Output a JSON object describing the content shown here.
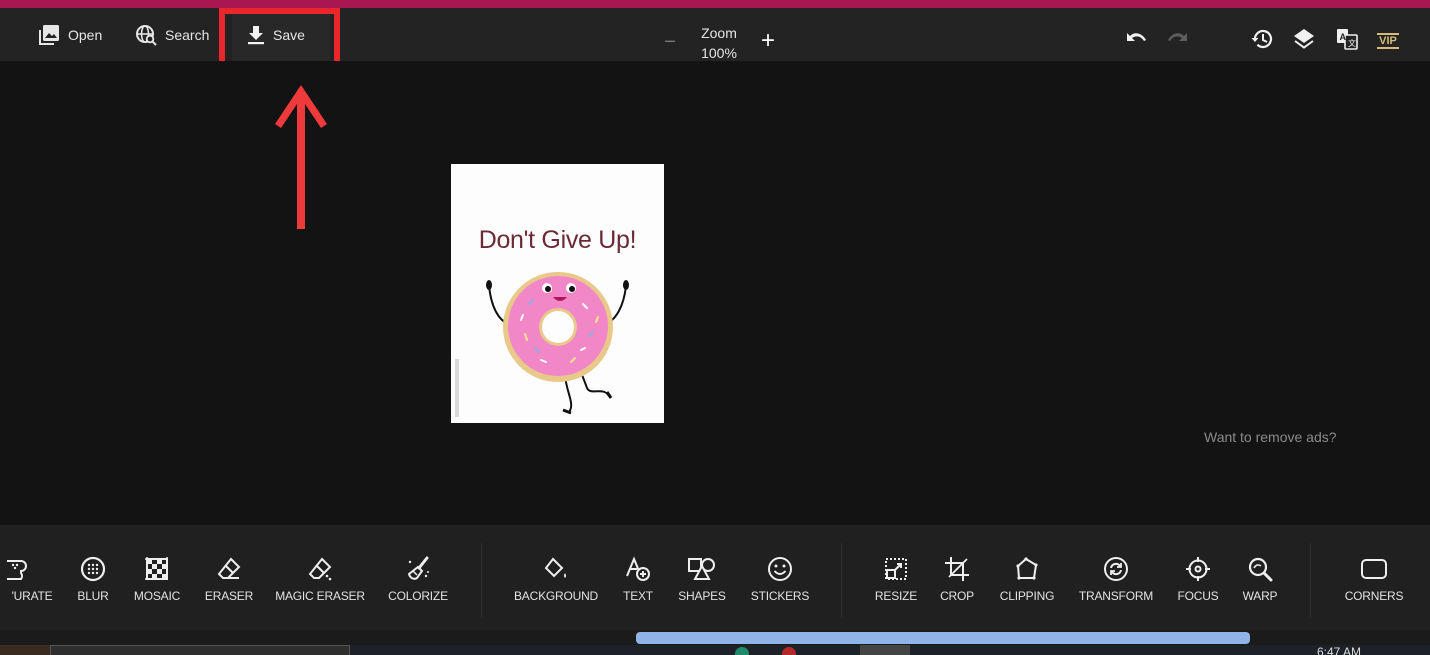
{
  "topbar": {
    "open_label": "Open",
    "search_label": "Search",
    "save_label": "Save",
    "zoom_title": "Zoom",
    "zoom_value": "100%",
    "zoom_minus": "−",
    "zoom_plus": "+",
    "vip_label": "VIP",
    "icons": [
      "image-open-icon",
      "globe-search-icon",
      "download-icon",
      "undo-icon",
      "redo-icon",
      "history-icon",
      "layers-icon",
      "translate-icon",
      "vip-icon"
    ]
  },
  "annotation": {
    "highlight_target": "Save",
    "highlight_color": "#e8262b"
  },
  "canvas": {
    "image_title": "Don't Give Up!",
    "image_subject": "dancing pink frosted donut with sprinkles",
    "remove_ads_link": "Want to remove ads?"
  },
  "toolbar": {
    "groups": [
      {
        "tools": [
          {
            "label": "'URATE",
            "icon": "saturate-icon"
          },
          {
            "label": "BLUR",
            "icon": "blur-icon"
          },
          {
            "label": "MOSAIC",
            "icon": "mosaic-icon"
          },
          {
            "label": "ERASER",
            "icon": "eraser-icon"
          },
          {
            "label": "MAGIC ERASER",
            "icon": "magic-eraser-icon"
          },
          {
            "label": "COLORIZE",
            "icon": "colorize-brush-icon"
          }
        ]
      },
      {
        "tools": [
          {
            "label": "BACKGROUND",
            "icon": "paint-bucket-icon"
          },
          {
            "label": "TEXT",
            "icon": "add-text-icon"
          },
          {
            "label": "SHAPES",
            "icon": "shapes-icon"
          },
          {
            "label": "STICKERS",
            "icon": "smiley-icon"
          }
        ]
      },
      {
        "tools": [
          {
            "label": "RESIZE",
            "icon": "resize-icon"
          },
          {
            "label": "CROP",
            "icon": "crop-icon"
          },
          {
            "label": "CLIPPING",
            "icon": "clipping-polygon-icon"
          },
          {
            "label": "TRANSFORM",
            "icon": "transform-rotate-icon"
          },
          {
            "label": "FOCUS",
            "icon": "focus-target-icon"
          },
          {
            "label": "WARP",
            "icon": "warp-magnifier-icon"
          }
        ]
      },
      {
        "tools": [
          {
            "label": "CORNERS",
            "icon": "corners-icon"
          }
        ]
      }
    ],
    "scroll_color": "#8fb4e6"
  },
  "taskbar": {
    "clock": "6:47 AM"
  },
  "colors": {
    "top_strip": "#a8174f",
    "topbar_bg": "#232323",
    "canvas_bg": "#131313",
    "toolbar_bg": "#202020",
    "vip": "#d9b97a",
    "title_text": "#6b2a36"
  }
}
